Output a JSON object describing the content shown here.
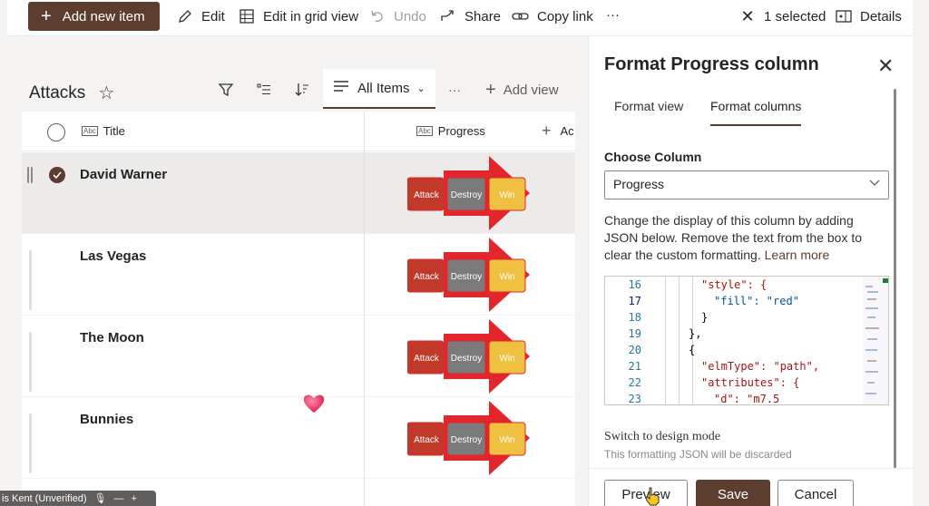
{
  "toolbar": {
    "add_new_item": "Add new item",
    "edit": "Edit",
    "edit_grid": "Edit in grid view",
    "undo": "Undo",
    "share": "Share",
    "copy_link": "Copy link",
    "more": "···",
    "selected": "1 selected",
    "details": "Details"
  },
  "list": {
    "title": "Attacks",
    "view_name": "All Items",
    "more": "···",
    "add_view": "Add view",
    "columns": {
      "title": "Title",
      "progress": "Progress",
      "add_column": "Ac"
    },
    "rows": [
      {
        "title": "David Warner",
        "selected": true
      },
      {
        "title": "Las Vegas",
        "selected": false
      },
      {
        "title": "The Moon",
        "selected": false
      },
      {
        "title": "Bunnies",
        "selected": false
      }
    ],
    "progress_steps": [
      "Attack",
      "Destroy",
      "Win"
    ],
    "progress_colors": [
      "#c0392b",
      "#7a7a7a",
      "#f0c040"
    ],
    "arrow_color": "#e3262b"
  },
  "panel": {
    "title": "Format Progress column",
    "tab_view": "Format view",
    "tab_columns": "Format columns",
    "choose_label": "Choose Column",
    "column_value": "Progress",
    "description": "Change the display of this column by adding JSON below. Remove the text from the box to clear the custom formatting.",
    "learn_more": "Learn more",
    "code_lines": [
      {
        "n": "16",
        "text": "\"style\": {"
      },
      {
        "n": "17",
        "text": "\"fill\": \"red\""
      },
      {
        "n": "18",
        "text": "}"
      },
      {
        "n": "19",
        "text": "},"
      },
      {
        "n": "20",
        "text": "{"
      },
      {
        "n": "21",
        "text": "\"elmType\": \"path\","
      },
      {
        "n": "22",
        "text": "\"attributes\": {"
      },
      {
        "n": "23",
        "text": "\"d\": \"m7.5"
      }
    ],
    "switch_mode": "Switch to design mode",
    "discard_note": "This formatting JSON will be discarded",
    "preview": "Preview",
    "save": "Save",
    "cancel": "Cancel"
  },
  "presenter": {
    "name": "is Kent (Unverified)"
  }
}
